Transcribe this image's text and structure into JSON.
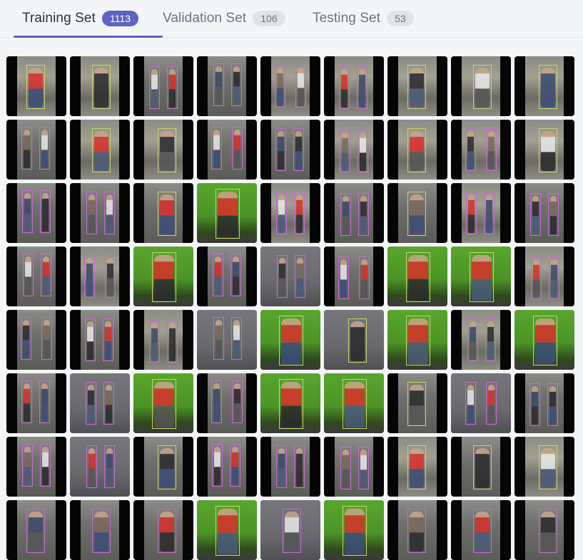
{
  "tabs": [
    {
      "label": "Training Set",
      "count": "1113",
      "active": true
    },
    {
      "label": "Validation Set",
      "count": "106",
      "active": false
    },
    {
      "label": "Testing Set",
      "count": "53",
      "active": false
    }
  ],
  "colors": {
    "accent": "#5b63c4",
    "box_pink": "#c86bd6",
    "box_lime": "#c7d66a",
    "green_screen": "#4c9426"
  },
  "gallery": {
    "rows": [
      [
        {
          "scene": "street",
          "boxes": [
            {
              "c": "lime"
            }
          ]
        },
        {
          "scene": "street",
          "boxes": [
            {
              "c": "lime"
            }
          ]
        },
        {
          "scene": "dark",
          "boxes": [
            {
              "c": "pink"
            },
            {
              "c": "pink"
            }
          ]
        },
        {
          "scene": "dark",
          "boxes": [
            {
              "c": "pink"
            },
            {
              "c": "pink"
            }
          ]
        },
        {
          "scene": "street",
          "boxes": [
            {
              "c": "pink"
            },
            {
              "c": "pink"
            }
          ]
        },
        {
          "scene": "street",
          "boxes": [
            {
              "c": "pink"
            },
            {
              "c": "pink"
            }
          ]
        },
        {
          "scene": "street",
          "boxes": [
            {
              "c": "lime"
            }
          ]
        },
        {
          "scene": "street",
          "boxes": [
            {
              "c": "lime"
            }
          ]
        },
        {
          "scene": "street",
          "boxes": [
            {
              "c": "lime"
            }
          ]
        }
      ],
      [
        {
          "scene": "dark",
          "boxes": [
            {
              "c": "pink"
            },
            {
              "c": "pink"
            }
          ]
        },
        {
          "scene": "street",
          "boxes": [
            {
              "c": "lime"
            }
          ]
        },
        {
          "scene": "street",
          "boxes": [
            {
              "c": "lime"
            }
          ]
        },
        {
          "scene": "dark",
          "boxes": [
            {
              "c": "pink"
            },
            {
              "c": "pink"
            }
          ]
        },
        {
          "scene": "dark",
          "boxes": [
            {
              "c": "pink"
            },
            {
              "c": "pink"
            }
          ]
        },
        {
          "scene": "street",
          "boxes": [
            {
              "c": "pink"
            },
            {
              "c": "pink"
            }
          ]
        },
        {
          "scene": "street",
          "boxes": [
            {
              "c": "lime"
            }
          ]
        },
        {
          "scene": "street",
          "boxes": [
            {
              "c": "pink"
            },
            {
              "c": "pink"
            }
          ]
        },
        {
          "scene": "street",
          "boxes": [
            {
              "c": "lime"
            }
          ]
        }
      ],
      [
        {
          "scene": "dark",
          "boxes": [
            {
              "c": "pink"
            },
            {
              "c": "pink"
            }
          ]
        },
        {
          "scene": "dark",
          "boxes": [
            {
              "c": "pink"
            },
            {
              "c": "pink"
            }
          ]
        },
        {
          "scene": "dark",
          "boxes": [
            {
              "c": "lime"
            }
          ]
        },
        {
          "scene": "green",
          "boxes": [
            {
              "c": "lime"
            }
          ]
        },
        {
          "scene": "street",
          "boxes": [
            {
              "c": "pink"
            },
            {
              "c": "pink"
            }
          ]
        },
        {
          "scene": "dark",
          "boxes": [
            {
              "c": "pink"
            },
            {
              "c": "pink"
            }
          ]
        },
        {
          "scene": "dark",
          "boxes": [
            {
              "c": "lime"
            }
          ]
        },
        {
          "scene": "street",
          "boxes": [
            {
              "c": "pink"
            },
            {
              "c": "pink"
            }
          ]
        },
        {
          "scene": "dark",
          "boxes": [
            {
              "c": "pink"
            },
            {
              "c": "pink"
            }
          ]
        }
      ],
      [
        {
          "scene": "dark",
          "boxes": [
            {
              "c": "pink"
            },
            {
              "c": "pink"
            }
          ]
        },
        {
          "scene": "street",
          "boxes": [
            {
              "c": "pink"
            },
            {
              "c": "pink"
            }
          ]
        },
        {
          "scene": "green",
          "boxes": [
            {
              "c": "lime"
            }
          ]
        },
        {
          "scene": "dark",
          "boxes": [
            {
              "c": "pink"
            },
            {
              "c": "pink"
            }
          ]
        },
        {
          "scene": "gray",
          "boxes": [
            {
              "c": "pink"
            },
            {
              "c": "pink"
            }
          ]
        },
        {
          "scene": "dark",
          "boxes": [
            {
              "c": "pink"
            },
            {
              "c": "pink"
            }
          ]
        },
        {
          "scene": "green",
          "boxes": [
            {
              "c": "lime"
            }
          ]
        },
        {
          "scene": "green",
          "boxes": [
            {
              "c": "lime"
            }
          ]
        },
        {
          "scene": "street",
          "boxes": [
            {
              "c": "pink"
            },
            {
              "c": "pink"
            }
          ]
        }
      ],
      [
        {
          "scene": "dark",
          "boxes": [
            {
              "c": "pink"
            },
            {
              "c": "pink"
            }
          ]
        },
        {
          "scene": "dark",
          "boxes": [
            {
              "c": "pink"
            },
            {
              "c": "pink"
            }
          ]
        },
        {
          "scene": "street",
          "boxes": [
            {
              "c": "pink"
            },
            {
              "c": "pink"
            }
          ]
        },
        {
          "scene": "gray",
          "boxes": [
            {
              "c": "pink"
            },
            {
              "c": "pink"
            }
          ]
        },
        {
          "scene": "green",
          "boxes": [
            {
              "c": "lime"
            }
          ]
        },
        {
          "scene": "gray",
          "boxes": [
            {
              "c": "lime"
            }
          ]
        },
        {
          "scene": "green",
          "boxes": [
            {
              "c": "lime"
            }
          ]
        },
        {
          "scene": "street",
          "boxes": [
            {
              "c": "pink"
            },
            {
              "c": "pink"
            }
          ]
        },
        {
          "scene": "green",
          "boxes": [
            {
              "c": "lime"
            }
          ]
        }
      ],
      [
        {
          "scene": "dark",
          "boxes": [
            {
              "c": "pink"
            },
            {
              "c": "pink"
            }
          ]
        },
        {
          "scene": "gray",
          "boxes": [
            {
              "c": "pink"
            },
            {
              "c": "pink"
            }
          ]
        },
        {
          "scene": "green",
          "boxes": [
            {
              "c": "lime"
            }
          ]
        },
        {
          "scene": "dark",
          "boxes": [
            {
              "c": "pink"
            },
            {
              "c": "pink"
            }
          ]
        },
        {
          "scene": "green",
          "boxes": [
            {
              "c": "lime"
            }
          ]
        },
        {
          "scene": "green",
          "boxes": [
            {
              "c": "lime"
            }
          ]
        },
        {
          "scene": "dark",
          "boxes": [
            {
              "c": "lime"
            }
          ]
        },
        {
          "scene": "gray",
          "boxes": [
            {
              "c": "pink"
            },
            {
              "c": "pink"
            }
          ]
        },
        {
          "scene": "dark",
          "boxes": [
            {
              "c": "pink"
            },
            {
              "c": "pink"
            }
          ]
        }
      ],
      [
        {
          "scene": "dark",
          "boxes": [
            {
              "c": "pink"
            },
            {
              "c": "pink"
            }
          ]
        },
        {
          "scene": "gray",
          "boxes": [
            {
              "c": "pink"
            },
            {
              "c": "pink"
            }
          ]
        },
        {
          "scene": "dark",
          "boxes": [
            {
              "c": "lime"
            }
          ]
        },
        {
          "scene": "dark",
          "boxes": [
            {
              "c": "pink"
            },
            {
              "c": "pink"
            }
          ]
        },
        {
          "scene": "dark",
          "boxes": [
            {
              "c": "pink"
            },
            {
              "c": "pink"
            }
          ]
        },
        {
          "scene": "dark",
          "boxes": [
            {
              "c": "pink"
            },
            {
              "c": "pink"
            }
          ]
        },
        {
          "scene": "street",
          "boxes": [
            {
              "c": "lime"
            }
          ]
        },
        {
          "scene": "dark",
          "boxes": [
            {
              "c": "lime"
            }
          ]
        },
        {
          "scene": "street",
          "boxes": [
            {
              "c": "lime"
            }
          ]
        }
      ],
      [
        {
          "scene": "dark",
          "boxes": [
            {
              "c": "pink"
            }
          ]
        },
        {
          "scene": "dark",
          "boxes": [
            {
              "c": "pink"
            }
          ]
        },
        {
          "scene": "dark",
          "boxes": [
            {
              "c": "pink"
            }
          ]
        },
        {
          "scene": "green",
          "boxes": [
            {
              "c": "lime"
            }
          ]
        },
        {
          "scene": "gray",
          "boxes": [
            {
              "c": "pink"
            }
          ]
        },
        {
          "scene": "green",
          "boxes": [
            {
              "c": "lime"
            }
          ]
        },
        {
          "scene": "dark",
          "boxes": [
            {
              "c": "pink"
            }
          ]
        },
        {
          "scene": "dark",
          "boxes": [
            {
              "c": "pink"
            }
          ]
        },
        {
          "scene": "dark",
          "boxes": [
            {
              "c": "pink"
            }
          ]
        }
      ]
    ]
  }
}
